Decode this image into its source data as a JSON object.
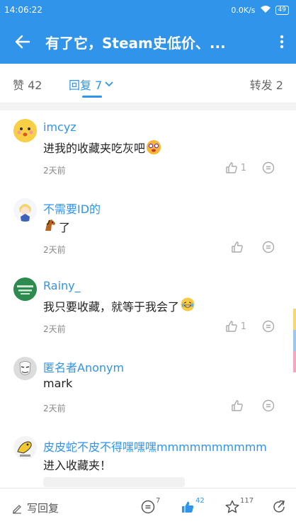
{
  "status_bar": {
    "time": "14:06:22",
    "speed": "0.0K/s",
    "battery": "49"
  },
  "app_bar": {
    "title": "有了它，Steam史低价、..."
  },
  "tabs": {
    "likes": "赞 42",
    "replies": "回复 7",
    "forwards": "转发 2"
  },
  "comments": [
    {
      "user": "imcyz",
      "text": "进我的收藏夹吃灰吧",
      "time": "2天前",
      "likes": "1"
    },
    {
      "user": "不需要ID的",
      "text": "了",
      "time": "2天前",
      "likes": ""
    },
    {
      "user": "Rainy_",
      "text": "我只要收藏，就等于我会了",
      "time": "2天前",
      "likes": "1"
    },
    {
      "user": "匿名者Anonym",
      "text": "mark",
      "time": "2天前",
      "likes": ""
    },
    {
      "user": "皮皮蛇不皮不得嘿嘿嘿mmmmmmmmmm",
      "text": "进入收藏夹！",
      "time": "",
      "likes": ""
    }
  ],
  "bottom_bar": {
    "write_reply": "写回复",
    "reply_count": "7",
    "like_count": "42",
    "favorite_count": "117"
  },
  "colors": {
    "accent": "#2f94ea",
    "muted": "#888888"
  }
}
